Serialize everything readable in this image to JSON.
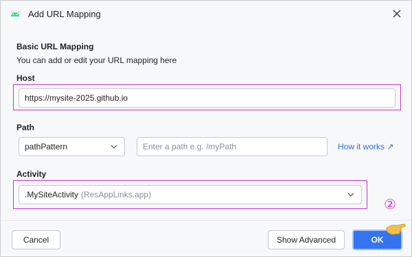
{
  "window": {
    "title": "Add URL Mapping",
    "app_icon": "android-icon",
    "close_icon": "close-icon"
  },
  "basic": {
    "title": "Basic URL Mapping",
    "description": "You can add or edit your URL mapping here"
  },
  "host": {
    "label": "Host",
    "value": "https://mysite-2025.github.io"
  },
  "path": {
    "label": "Path",
    "type_selected": "pathPattern",
    "placeholder": "Enter a path e.g. /myPath",
    "help_link": "How it works ↗"
  },
  "activity": {
    "label": "Activity",
    "name": ".MySiteActivity",
    "detail": "(ResAppLinks.app)"
  },
  "buttons": {
    "cancel": "Cancel",
    "show_advanced": "Show Advanced",
    "ok": "OK"
  },
  "annotation": {
    "step": "②"
  },
  "colors": {
    "accent": "#3574f0",
    "highlight": "#c733c7",
    "link": "#2f6fd6"
  }
}
